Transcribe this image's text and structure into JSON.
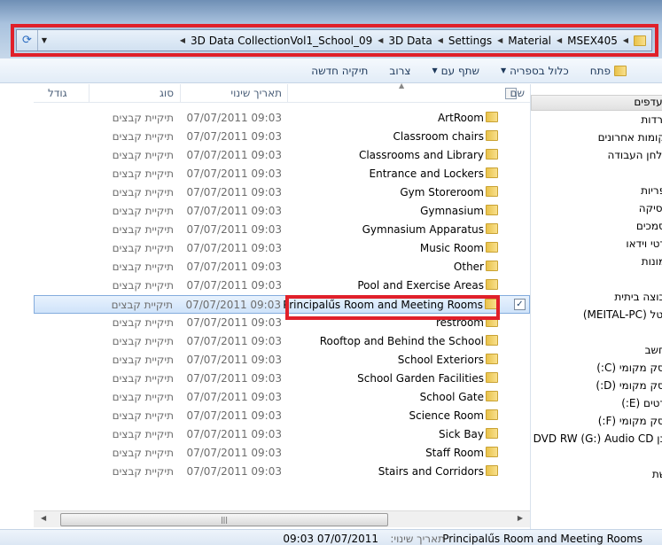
{
  "address": {
    "crumbs": [
      "MSEX405",
      "Material",
      "Settings",
      "3D Data",
      "3D Data CollectionVol1_School_09"
    ]
  },
  "toolbar": {
    "open": "פתח",
    "include": "כלול בספריה",
    "share": "שתף עם",
    "burn": "צרוב",
    "new_folder": "תיקיה חדשה"
  },
  "columns": {
    "name": "שם",
    "date": "תאריך שינוי",
    "type": "סוג",
    "size": "גודל"
  },
  "files": [
    {
      "name": "ArtRoom",
      "date": "07/07/2011 09:03",
      "type": "תיקיית קבצים"
    },
    {
      "name": "Classroom chairs",
      "date": "07/07/2011 09:03",
      "type": "תיקיית קבצים"
    },
    {
      "name": "Classrooms and Library",
      "date": "07/07/2011 09:03",
      "type": "תיקיית קבצים"
    },
    {
      "name": "Entrance and Lockers",
      "date": "07/07/2011 09:03",
      "type": "תיקיית קבצים"
    },
    {
      "name": "Gym Storeroom",
      "date": "07/07/2011 09:03",
      "type": "תיקיית קבצים"
    },
    {
      "name": "Gymnasium",
      "date": "07/07/2011 09:03",
      "type": "תיקיית קבצים"
    },
    {
      "name": "Gymnasium Apparatus",
      "date": "07/07/2011 09:03",
      "type": "תיקיית קבצים"
    },
    {
      "name": "Music Room",
      "date": "07/07/2011 09:03",
      "type": "תיקיית קבצים"
    },
    {
      "name": "Other",
      "date": "07/07/2011 09:03",
      "type": "תיקיית קבצים"
    },
    {
      "name": "Pool and Exercise Areas",
      "date": "07/07/2011 09:03",
      "type": "תיקיית קבצים"
    },
    {
      "name": "Principalűs Room and Meeting Rooms",
      "date": "07/07/2011 09:03",
      "type": "תיקיית קבצים",
      "selected": true
    },
    {
      "name": "restroom",
      "date": "07/07/2011 09:03",
      "type": "תיקיית קבצים"
    },
    {
      "name": "Rooftop and Behind the School",
      "date": "07/07/2011 09:03",
      "type": "תיקיית קבצים"
    },
    {
      "name": "School Exteriors",
      "date": "07/07/2011 09:03",
      "type": "תיקיית קבצים"
    },
    {
      "name": "School Garden Facilities",
      "date": "07/07/2011 09:03",
      "type": "תיקיית קבצים"
    },
    {
      "name": "School Gate",
      "date": "07/07/2011 09:03",
      "type": "תיקיית קבצים"
    },
    {
      "name": "Science Room",
      "date": "07/07/2011 09:03",
      "type": "תיקיית קבצים"
    },
    {
      "name": "Sick Bay",
      "date": "07/07/2011 09:03",
      "type": "תיקיית קבצים"
    },
    {
      "name": "Staff Room",
      "date": "07/07/2011 09:03",
      "type": "תיקיית קבצים"
    },
    {
      "name": "Stairs and Corridors",
      "date": "07/07/2011 09:03",
      "type": "תיקיית קבצים"
    }
  ],
  "nav": [
    {
      "label": "מועדפים",
      "header": true
    },
    {
      "label": "הורדות"
    },
    {
      "label": "מקומות אחרונים"
    },
    {
      "label": "שולחן העבודה"
    },
    {
      "label": "ספריות",
      "gap": true
    },
    {
      "label": "מוסיקה"
    },
    {
      "label": "מסמכים"
    },
    {
      "label": "סרטי וידאו"
    },
    {
      "label": "תמונות"
    },
    {
      "label": "קבוצה ביתית",
      "gap": true
    },
    {
      "label": "מיטל (MEITAL-PC)"
    },
    {
      "label": "מחשב",
      "gap": true
    },
    {
      "label": "דיסק מקומי (C:)"
    },
    {
      "label": "דיסק מקומי (D:)"
    },
    {
      "label": "סרטים (E:)"
    },
    {
      "label": "דיסק מקומי (F:)"
    },
    {
      "label": "כונן DVD RW (G:) Audio CD"
    },
    {
      "label": "רשת",
      "gap": true
    }
  ],
  "status": {
    "name": "Principalűs Room and Meeting Rooms",
    "date_label": "תאריך שינוי:",
    "date": "07/07/2011 09:03"
  }
}
